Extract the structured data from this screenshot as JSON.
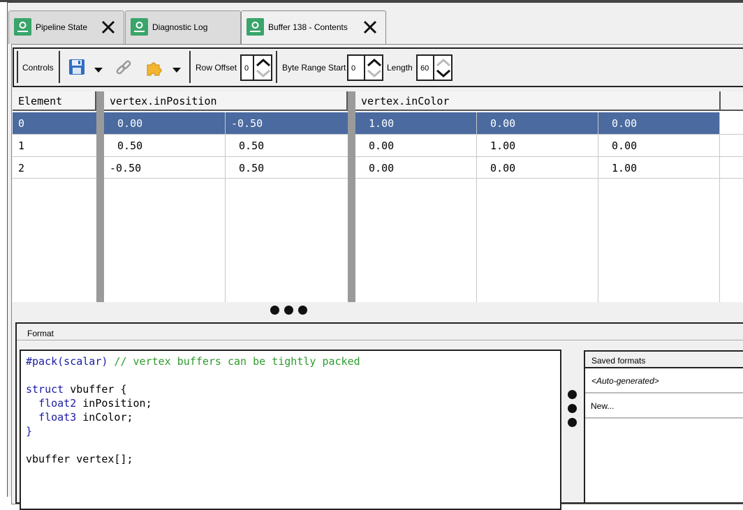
{
  "tabs": [
    {
      "label": "Pipeline State"
    },
    {
      "label": "Diagnostic Log"
    },
    {
      "label": "Buffer 138 - Contents"
    }
  ],
  "toolbar": {
    "controls_label": "Controls",
    "row_offset_label": "Row Offset",
    "row_offset_value": "0",
    "byte_range_start_label": "Byte Range Start",
    "byte_range_start_value": "0",
    "length_label": "Length",
    "length_value": "60",
    "icons": [
      "save-icon",
      "dropdown-arrow-icon",
      "link-icon",
      "puzzle-icon",
      "dropdown-arrow-icon"
    ]
  },
  "table": {
    "headers": [
      "Element",
      "vertex.inPosition",
      "vertex.inColor"
    ],
    "selected_row": 0,
    "rows": [
      [
        "0",
        " 0.00",
        "-0.50",
        " 1.00",
        " 0.00",
        " 0.00"
      ],
      [
        "1",
        " 0.50",
        " 0.50",
        " 0.00",
        " 1.00",
        " 0.00"
      ],
      [
        "2",
        "-0.50",
        " 0.50",
        " 0.00",
        " 0.00",
        " 1.00"
      ]
    ]
  },
  "format": {
    "title": "Format",
    "code_lines": [
      {
        "directive": "#pack(scalar)",
        "comment": " // vertex buffers can be tightly packed"
      },
      {
        "text": ""
      },
      {
        "keyword": "struct",
        "text": " vbuffer {"
      },
      {
        "indent": "  ",
        "keyword": "float2",
        "text": " inPosition;"
      },
      {
        "indent": "  ",
        "keyword": "float3",
        "text": " inColor;"
      },
      {
        "keyword": "}",
        "text": ""
      },
      {
        "text": ""
      },
      {
        "text": "vbuffer vertex[];"
      }
    ]
  },
  "saved_formats": {
    "title": "Saved formats",
    "items": [
      "<Auto-generated>",
      "New..."
    ]
  },
  "colors": {
    "selection": "#4a6aa0",
    "tab_icon": "#3aa56a",
    "keyword": "#1a1aa6",
    "comment": "#2e9b2e"
  }
}
